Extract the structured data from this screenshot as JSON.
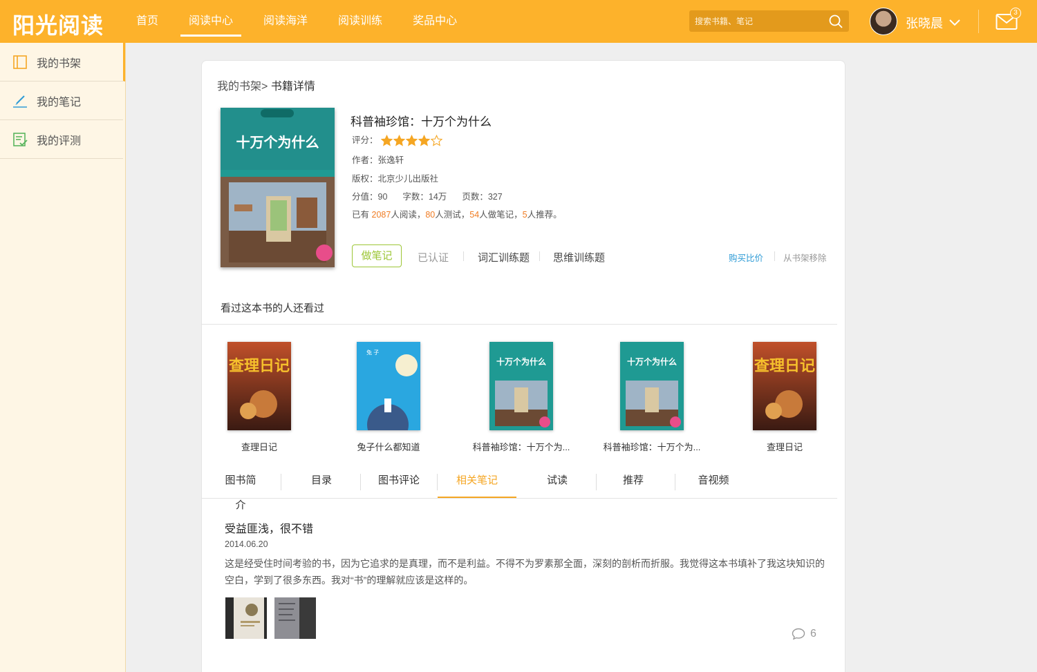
{
  "header": {
    "logo": "阳光阅读",
    "nav": [
      "首页",
      "阅读中心",
      "阅读海洋",
      "阅读训练",
      "奖品中心"
    ],
    "active_nav": "阅读中心",
    "search_placeholder": "搜索书籍、笔记",
    "username": "张晓晨",
    "mail_count": "3"
  },
  "sidebar": {
    "items": [
      {
        "label": "我的书架",
        "icon": "bookshelf-icon"
      },
      {
        "label": "我的笔记",
        "icon": "pencil-icon"
      },
      {
        "label": "我的评测",
        "icon": "checklist-icon"
      }
    ]
  },
  "breadcrumb": {
    "parent": "我的书架>",
    "current": "书籍详情"
  },
  "book": {
    "title": "科普袖珍馆：十万个为什么",
    "rating_label": "评分：",
    "rating": 4,
    "rating_max": 5,
    "author": "作者：张逸轩",
    "publisher": "版权：北京少儿出版社",
    "score": "分值：90",
    "words": "字数：14万",
    "pages": "页数：327",
    "stats_prefix": "已有",
    "readers": "2087",
    "readers_suffix": "人阅读，",
    "testers": "80",
    "testers_suffix": "人测试，",
    "noters": "54",
    "noters_suffix": "人做笔记，",
    "recommenders": "5",
    "recommenders_suffix": "人推荐。",
    "cover_text": "十万个为什么"
  },
  "actions": {
    "note": "做笔记",
    "certified": "已认证",
    "vocab": "词汇训练题",
    "thinking": "思维训练题",
    "buy": "购买比价",
    "remove": "从书架移除"
  },
  "related": {
    "title": "看过这本书的人还看过",
    "books": [
      {
        "name": "查理日记",
        "cover": "red"
      },
      {
        "name": "兔子什么都知道",
        "cover": "blue"
      },
      {
        "name": "科普袖珍馆：十万个为...",
        "cover": "teal"
      },
      {
        "name": "科普袖珍馆：十万个为...",
        "cover": "teal"
      },
      {
        "name": "查理日记",
        "cover": "red"
      }
    ]
  },
  "tabs": [
    "图书简介",
    "目录",
    "图书评论",
    "相关笔记",
    "试读",
    "推荐",
    "音视频"
  ],
  "active_tab": "相关笔记",
  "note": {
    "title": "受益匪浅，很不错",
    "date": "2014.06.20",
    "body": "这是经受住时间考验的书，因为它追求的是真理，而不是利益。不得不为罗素那全面，深刻的剖析而折服。我觉得这本书填补了我这块知识的空白，学到了很多东西。我对“书”的理解就应该是这样的。",
    "comment_count": "6"
  },
  "colors": {
    "brand": "#fdb22b",
    "highlight": "#f07d24",
    "link": "#2e9bd6",
    "note_button": "#9cc635"
  }
}
